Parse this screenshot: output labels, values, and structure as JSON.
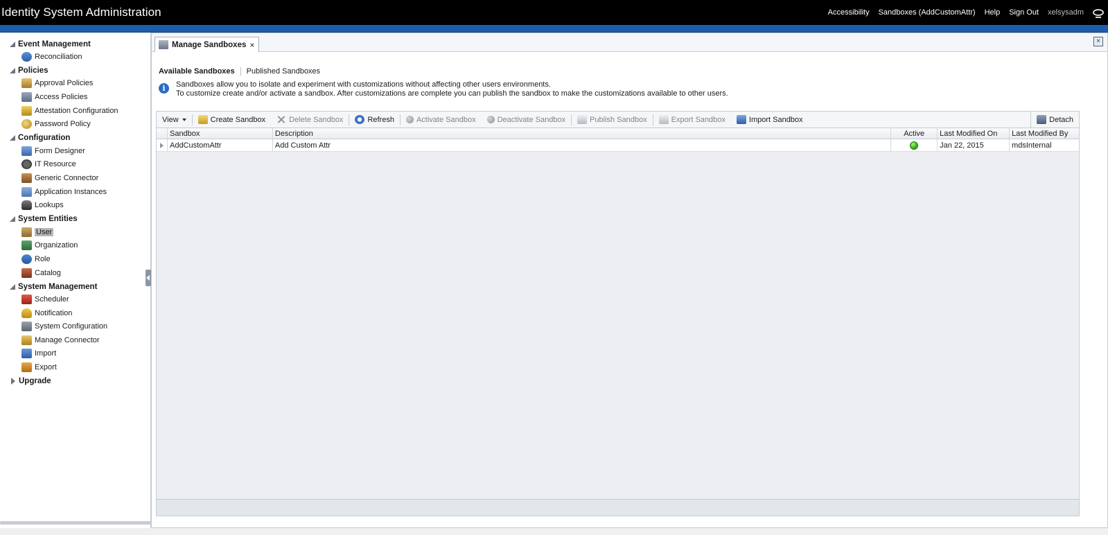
{
  "header": {
    "title": "Identity System Administration",
    "links": {
      "accessibility": "Accessibility",
      "sandboxes": "Sandboxes (AddCustomAttr)",
      "help": "Help",
      "signout": "Sign Out",
      "user": "xelsysadm"
    }
  },
  "nav": {
    "groups": [
      {
        "title": "Event Management",
        "items": [
          "Reconciliation"
        ]
      },
      {
        "title": "Policies",
        "items": [
          "Approval Policies",
          "Access Policies",
          "Attestation Configuration",
          "Password Policy"
        ]
      },
      {
        "title": "Configuration",
        "items": [
          "Form Designer",
          "IT Resource",
          "Generic Connector",
          "Application Instances",
          "Lookups"
        ]
      },
      {
        "title": "System Entities",
        "items": [
          "User",
          "Organization",
          "Role",
          "Catalog"
        ]
      },
      {
        "title": "System Management",
        "items": [
          "Scheduler",
          "Notification",
          "System Configuration",
          "Manage Connector",
          "Import",
          "Export"
        ]
      },
      {
        "title": "Upgrade",
        "items": []
      }
    ]
  },
  "main": {
    "tab_label": "Manage Sandboxes",
    "tab_close": "×",
    "subtabs": {
      "available": "Available Sandboxes",
      "published": "Published Sandboxes"
    },
    "info_icon": "i",
    "info": {
      "line1": "Sandboxes allow you to isolate and experiment with customizations without affecting other users environments.",
      "line2": "To customize create and/or activate a sandbox. After customizations are complete you can publish the sandbox to make the customizations available to other users."
    },
    "toolbar": {
      "view": "View",
      "create": "Create Sandbox",
      "delete": "Delete Sandbox",
      "refresh": "Refresh",
      "activate": "Activate Sandbox",
      "deactivate": "Deactivate Sandbox",
      "publish": "Publish Sandbox",
      "export": "Export Sandbox",
      "import": "Import Sandbox",
      "detach": "Detach"
    },
    "table": {
      "columns": [
        "Sandbox",
        "Description",
        "Active",
        "Last Modified On",
        "Last Modified By"
      ],
      "rows": [
        {
          "sandbox": "AddCustomAttr",
          "description": "Add Custom Attr",
          "active": true,
          "modified_on": "Jan 22, 2015",
          "modified_by": "mdsInternal"
        }
      ]
    }
  },
  "colors": {
    "header_bg": "#000000",
    "accent_bar": "#1d5dab",
    "active_indicator": "#2aa513"
  }
}
